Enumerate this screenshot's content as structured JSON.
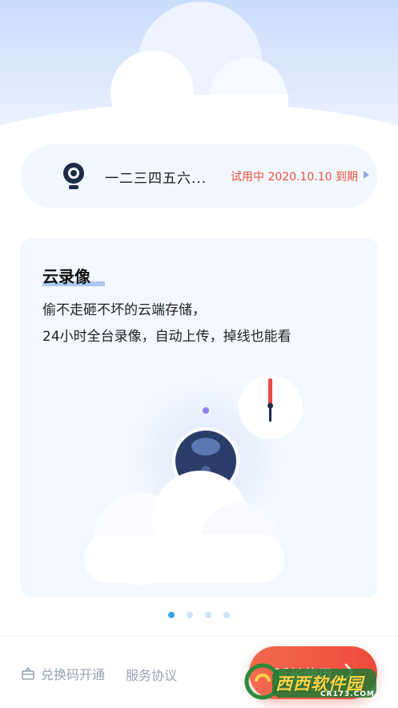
{
  "device": {
    "name": "一二三四五六...",
    "trial_status": "试用中 2020.10.10 到期",
    "icon": "camera-icon"
  },
  "feature": {
    "title": "云录像",
    "desc_line1": "偷不走砸不坏的云端存储，",
    "desc_line2": "24小时全台录像，自动上传，掉线也能看"
  },
  "pager": {
    "count": 4,
    "active_index": 0
  },
  "footer": {
    "redeem_label": "兑换码开通",
    "agreement_label": "服务协议",
    "extend_label": "延长使用"
  },
  "watermark": {
    "brand": "西西软件园",
    "domain": "CR173.COM"
  },
  "colors": {
    "accent_red": "#ee4a3c",
    "trial_text": "#e8523f",
    "active_dot": "#3aa2e6",
    "muted_text": "#9aa2b1"
  }
}
